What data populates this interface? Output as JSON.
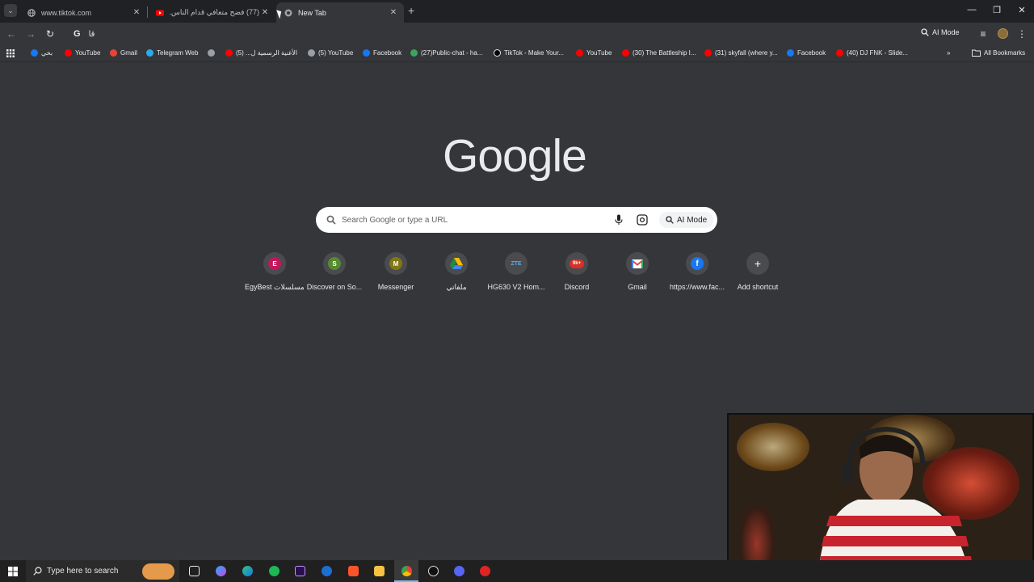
{
  "tabs": [
    {
      "title": "www.tiktok.com",
      "active": false
    },
    {
      "title": "(77) فضح متعافي قدام الناس...",
      "active": false
    },
    {
      "title": "New Tab",
      "active": true
    }
  ],
  "omnibox": {
    "typed": "قا"
  },
  "toolbar": {
    "ai_mode_label": "AI Mode"
  },
  "bookmarks": [
    {
      "label": "بخي",
      "icon": "facebook-icon"
    },
    {
      "label": "YouTube",
      "icon": "youtube-icon"
    },
    {
      "label": "Gmail",
      "icon": "gmail-icon"
    },
    {
      "label": "Telegram Web",
      "icon": "telegram-icon"
    },
    {
      "label": "",
      "icon": "globe-icon"
    },
    {
      "label": "الأغنية الرسمية ل... (5)",
      "icon": "youtube-icon"
    },
    {
      "label": "(5) YouTube",
      "icon": "globe-icon"
    },
    {
      "label": "Facebook",
      "icon": "facebook-icon"
    },
    {
      "label": "(27)Public-chat - ha...",
      "icon": "discord-icon"
    },
    {
      "label": "TikTok - Make Your...",
      "icon": "tiktok-icon"
    },
    {
      "label": "YouTube",
      "icon": "youtube-icon"
    },
    {
      "label": "(30) The Battleship I...",
      "icon": "youtube-icon"
    },
    {
      "label": "(31) skyfall (where y...",
      "icon": "youtube-icon"
    },
    {
      "label": "Facebook",
      "icon": "facebook-icon"
    },
    {
      "label": "(40) DJ FNK - Slide...",
      "icon": "youtube-icon"
    }
  ],
  "all_bookmarks_label": "All Bookmarks",
  "logo_text": "Google",
  "search": {
    "placeholder": "Search Google or type a URL",
    "ai_mode_label": "AI Mode"
  },
  "shortcuts": [
    {
      "label": "EgyBest مسلسلات...",
      "letter": "E",
      "color": "#c2185b"
    },
    {
      "label": "Discover on So...",
      "letter": "S",
      "color": "#558b2f"
    },
    {
      "label": "Messenger",
      "letter": "M",
      "color": "#827717"
    },
    {
      "label": "ملفاتي",
      "letter": "",
      "color": "#1e8e3e"
    },
    {
      "label": "HG630 V2 Hom...",
      "letter": "ZTE",
      "color": "#4a4b4f"
    },
    {
      "label": "Discord",
      "letter": "9k+",
      "color": "#d93025"
    },
    {
      "label": "Gmail",
      "letter": "M",
      "color": "#4a4b4f"
    },
    {
      "label": "https://www.fac...",
      "letter": "f",
      "color": "#1877f2"
    },
    {
      "label": "Add shortcut",
      "letter": "+",
      "color": "#4a4b4f"
    }
  ],
  "taskbar": {
    "search_placeholder": "Type here to search"
  }
}
